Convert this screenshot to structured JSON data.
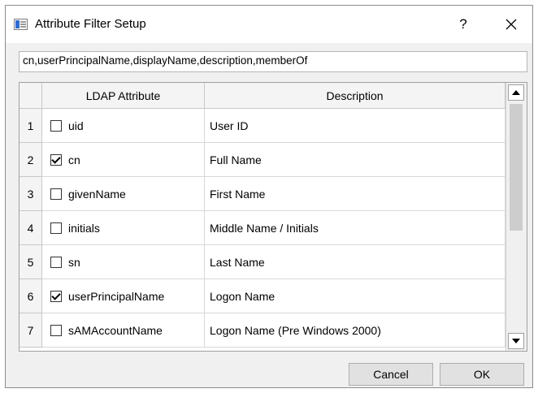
{
  "window": {
    "title": "Attribute Filter Setup",
    "help_label": "?",
    "close_label": "✕"
  },
  "filter": {
    "value": "cn,userPrincipalName,displayName,description,memberOf"
  },
  "table": {
    "columns": [
      "LDAP Attribute",
      "Description"
    ],
    "rows": [
      {
        "num": "1",
        "attribute": "uid",
        "description": "User ID",
        "checked": false
      },
      {
        "num": "2",
        "attribute": "cn",
        "description": "Full Name",
        "checked": true
      },
      {
        "num": "3",
        "attribute": "givenName",
        "description": "First Name",
        "checked": false
      },
      {
        "num": "4",
        "attribute": "initials",
        "description": "Middle Name / Initials",
        "checked": false
      },
      {
        "num": "5",
        "attribute": "sn",
        "description": "Last Name",
        "checked": false
      },
      {
        "num": "6",
        "attribute": "userPrincipalName",
        "description": "Logon Name",
        "checked": true
      },
      {
        "num": "7",
        "attribute": "sAMAccountName",
        "description": "Logon Name (Pre Windows 2000)",
        "checked": false
      }
    ]
  },
  "buttons": {
    "cancel_label": "Cancel",
    "ok_label": "OK"
  }
}
